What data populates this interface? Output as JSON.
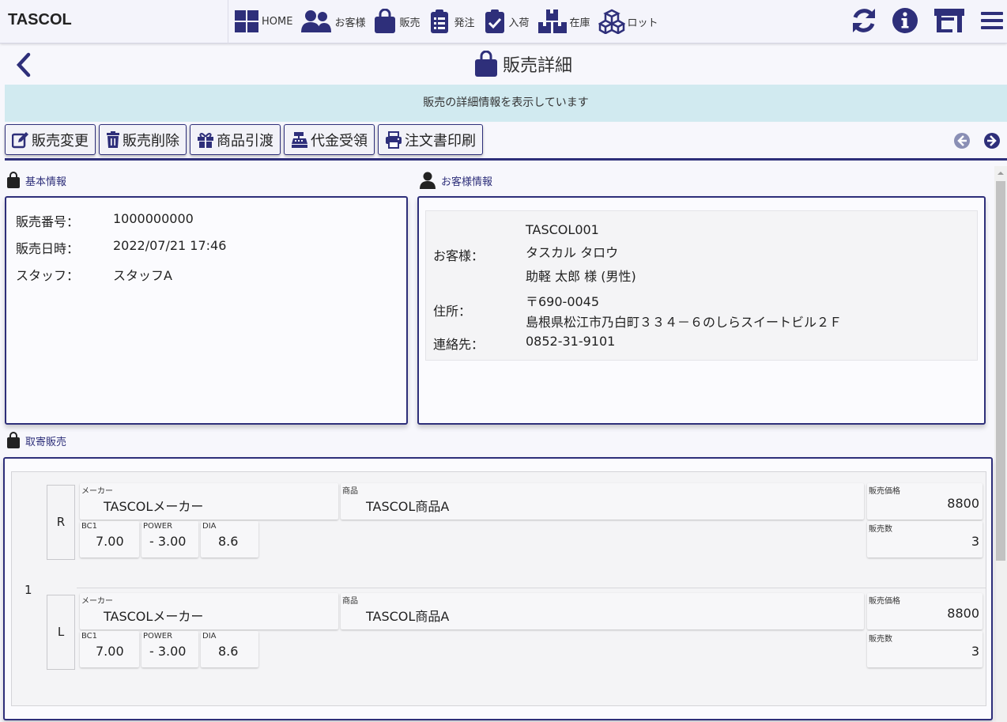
{
  "app": {
    "title": "TASCOL"
  },
  "nav": [
    {
      "label": "HOME",
      "icon": "grid-icon"
    },
    {
      "label": "お客様",
      "icon": "users-icon"
    },
    {
      "label": "販売",
      "icon": "shopping-bag-icon"
    },
    {
      "label": "発注",
      "icon": "clipboard-list-icon"
    },
    {
      "label": "入荷",
      "icon": "clipboard-check-icon"
    },
    {
      "label": "在庫",
      "icon": "boxes-icon"
    },
    {
      "label": "ロット",
      "icon": "cubes-icon"
    }
  ],
  "top_actions": [
    "refresh-icon",
    "info-icon",
    "store-icon",
    "menu-icon"
  ],
  "page": {
    "title": "販売詳細",
    "info_message": "販売の詳細情報を表示しています"
  },
  "actions": {
    "edit": "販売変更",
    "delete": "販売削除",
    "handover": "商品引渡",
    "payment": "代金受領",
    "print": "注文書印刷"
  },
  "basic": {
    "label": "基本情報",
    "rows": [
      {
        "key": "販売番号：",
        "value": "1000000000"
      },
      {
        "key": "販売日時：",
        "value": "2022/07/21 17:46"
      },
      {
        "key": "スタッフ：",
        "value": "スタッフA"
      }
    ]
  },
  "customer": {
    "label": "お客様情報",
    "customer_key": "お客様：",
    "customer_code": "TASCOL001",
    "customer_kana": "タスカル タロウ",
    "customer_name": "助軽 太郎 様 (男性)",
    "address_key": "住所：",
    "postal": "〒690-0045",
    "address": "島根県松江市乃白町３３４－６のしらスイートビル２Ｆ",
    "contact_key": "連絡先：",
    "phone": "0852-31-9101"
  },
  "trade": {
    "label": "取寄販売",
    "row_number": "1",
    "labels": {
      "maker": "メーカー",
      "product": "商品",
      "price": "販売価格",
      "qty": "販売数",
      "bc": "BC1",
      "power": "POWER",
      "dia": "DIA"
    },
    "right": {
      "side": "R",
      "maker": "TASCOLメーカー",
      "product": "TASCOL商品A",
      "price": "8800",
      "qty": "3",
      "bc": "7.00",
      "power": "- 3.00",
      "dia": "8.6"
    },
    "left": {
      "side": "L",
      "maker": "TASCOLメーカー",
      "product": "TASCOL商品A",
      "price": "8800",
      "qty": "3",
      "bc": "7.00",
      "power": "- 3.00",
      "dia": "8.6"
    }
  },
  "colors": {
    "primary": "#2e2f7a",
    "info_bg": "#d1eaf0",
    "panel_bg": "#f4f4f6"
  }
}
